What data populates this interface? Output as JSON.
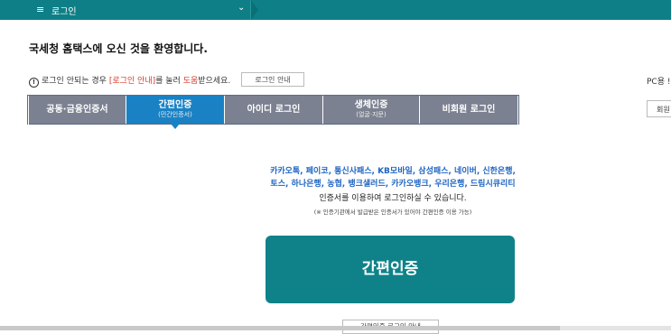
{
  "topbar": {
    "menu_icon": "≡",
    "title": "로그인",
    "chevron": "⌄"
  },
  "welcome": "국세청 홈택스에 오신 것을 환영합니다.",
  "notice": {
    "icon": "!",
    "prefix": "로그인 안되는 경우 ",
    "link": "[로그인 안내]",
    "middle": "를 눌러 ",
    "help": "도움",
    "suffix": "받으세요."
  },
  "guide_button": "로그인 안내",
  "pc_label": "PC용 !",
  "register_button": "회원",
  "tabs": [
    {
      "label": "공동·금융인증서",
      "sub": ""
    },
    {
      "label": "간편인증",
      "sub": "(민간인증서)"
    },
    {
      "label": "아이디 로그인",
      "sub": ""
    },
    {
      "label": "생체인증",
      "sub": "(얼굴·지문)"
    },
    {
      "label": "비회원 로그인",
      "sub": ""
    }
  ],
  "providers_line1": "카카오톡, 페이코, 통신사패스, KB모바일, 삼성패스, 네이버, 신한은행,",
  "providers_line2": "토스, 하나은행, 농협, 뱅크샐러드, 카카오뱅크, 우리은행, 드림시큐리티",
  "usage": "인증서를 이용하여 로그인하실 수 있습니다.",
  "footnote": "(※ 인증기관에서 발급받은 인증서가 있어야 간편인증 이용 가능)",
  "big_button": "간편인증",
  "sub_guide": "간편인증 로그인 안내",
  "colors": {
    "brand": "#0e7f86",
    "active_tab": "#1a82c4",
    "inactive_tab": "#7b8190",
    "provider_text": "#1e65c2",
    "alert_red": "#d73a2a"
  }
}
